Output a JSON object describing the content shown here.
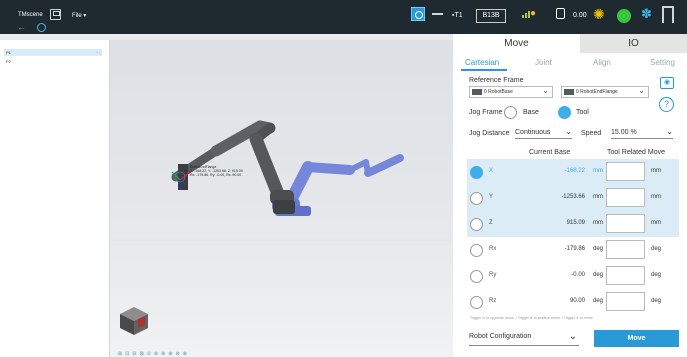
{
  "topbar": {
    "app_title": "TMscene",
    "file_menu": "File ▾",
    "mode": "T1",
    "project": "B13B",
    "speed": "0.00"
  },
  "tree": {
    "items": [
      "P1",
      "P2"
    ],
    "more": "..."
  },
  "scene": {
    "label_title": "RobotEndFlange",
    "label_line1": "X: -168.22, Y: -1253.66, Z: 915.09",
    "label_line2": "Rx: -179.86, Ry: -0.00, Rz: 90.00"
  },
  "panel": {
    "main_tabs": [
      "Move",
      "IO"
    ],
    "sub_tabs": [
      "Cartesian",
      "Joint",
      "Align",
      "Setting"
    ],
    "reference_frame_label": "Reference Frame",
    "base_select": "0 RobotBase",
    "tool_select": "0 RobotEndFlange",
    "help": "?",
    "jog_frame_label": "Jog Frame",
    "jog_frame_options": [
      "Base",
      "Tool"
    ],
    "jog_distance_label": "Jog Distance",
    "jog_distance_value": "Continuous",
    "speed_label": "Speed",
    "speed_value": "15.00 %",
    "col_current": "Current Base",
    "col_related": "Tool Related Move",
    "axes": [
      {
        "name": "X",
        "value": "-168.22",
        "unit": "mm",
        "unit2": "mm"
      },
      {
        "name": "Y",
        "value": "-1253.66",
        "unit": "mm",
        "unit2": "mm"
      },
      {
        "name": "Z",
        "value": "915.09",
        "unit": "mm",
        "unit2": "mm"
      },
      {
        "name": "Rx",
        "value": "-179.86",
        "unit": "deg",
        "unit2": "deg"
      },
      {
        "name": "Ry",
        "value": "-0.00",
        "unit": "deg",
        "unit2": "deg"
      },
      {
        "name": "Rz",
        "value": "90.00",
        "unit": "deg",
        "unit2": "deg"
      }
    ],
    "trigger_note": "Trigger ⊖ to opposite move. / Trigger ⊕ to positive move. / Trigger ✦ to move.",
    "robot_config": "Robot Configuration",
    "move_button": "Move"
  },
  "colors": {
    "accent": "#2a9ad6",
    "topbar_bg": "#1f2a30",
    "status_green": "#39c53d",
    "robot_dark": "#5a5e62",
    "robot_ghost": "#5b6fd4"
  }
}
